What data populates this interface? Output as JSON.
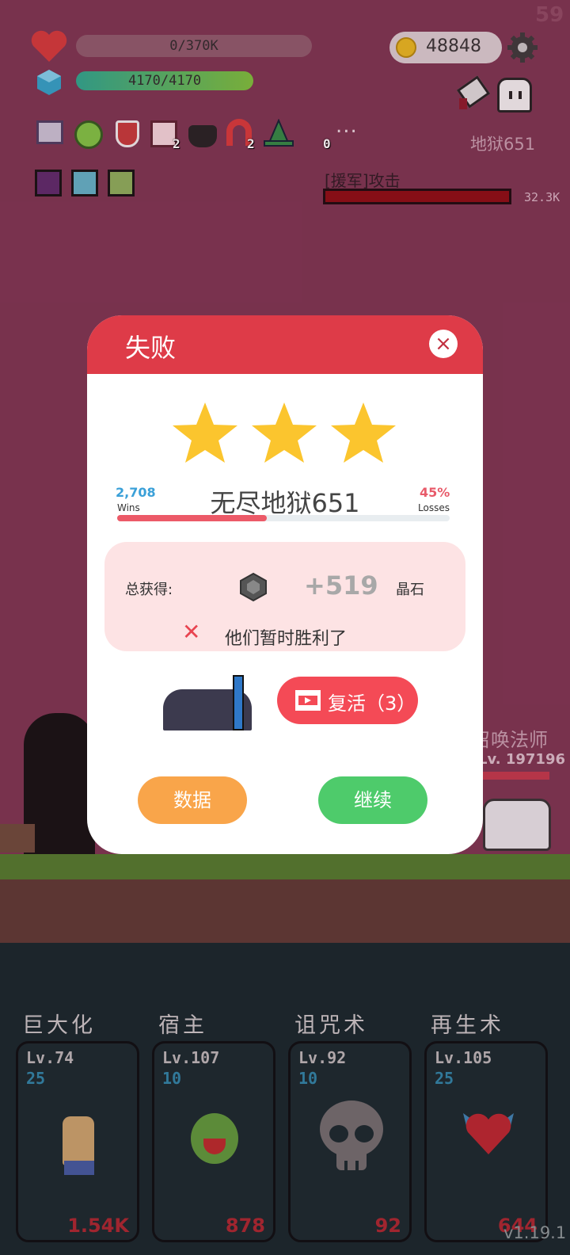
{
  "hud": {
    "fps": "59",
    "hp_text": "0/370K",
    "hp_fraction": 0,
    "shield_text": "4170/4170",
    "shield_fraction": 1.0,
    "gold": "48848",
    "item_counts": [
      "2",
      "2",
      "0"
    ],
    "more_label": "...",
    "stage_label": "地狱651",
    "enemy_title": "[援军]攻击",
    "enemy_hp": "32.3K"
  },
  "scene": {
    "enemy_name": "召唤法师",
    "enemy_level": "Lv. 197196"
  },
  "dialog": {
    "title": "失败",
    "close_label": "×",
    "stars_count": 3,
    "wins_value": "2,708",
    "wins_label": "Wins",
    "losses_value": "45%",
    "losses_label": "Losses",
    "loss_fraction": 0.45,
    "stage_name": "无尽地狱651",
    "reward_label": "总获得:",
    "reward_amount": "+519",
    "reward_unit": "晶石",
    "result_text": "他们暂时胜利了",
    "revive_label": "复活（3）",
    "stats_button": "数据",
    "continue_button": "继续"
  },
  "skills": [
    {
      "name": "巨大化",
      "level": "Lv.74",
      "sub": "25",
      "cost": "1.54K",
      "icon": "fist-icon"
    },
    {
      "name": "宿主",
      "level": "Lv.107",
      "sub": "10",
      "cost": "878",
      "icon": "green-monster-icon"
    },
    {
      "name": "诅咒术",
      "level": "Lv.92",
      "sub": "10",
      "cost": "92",
      "icon": "skull-icon"
    },
    {
      "name": "再生术",
      "level": "Lv.105",
      "sub": "25",
      "cost": "644",
      "icon": "winged-heart-icon"
    }
  ],
  "version": "v1.19.1",
  "colors": {
    "accent_red": "#de3b48",
    "continue_green": "#4ecb6b",
    "stats_orange": "#f9a54a"
  }
}
